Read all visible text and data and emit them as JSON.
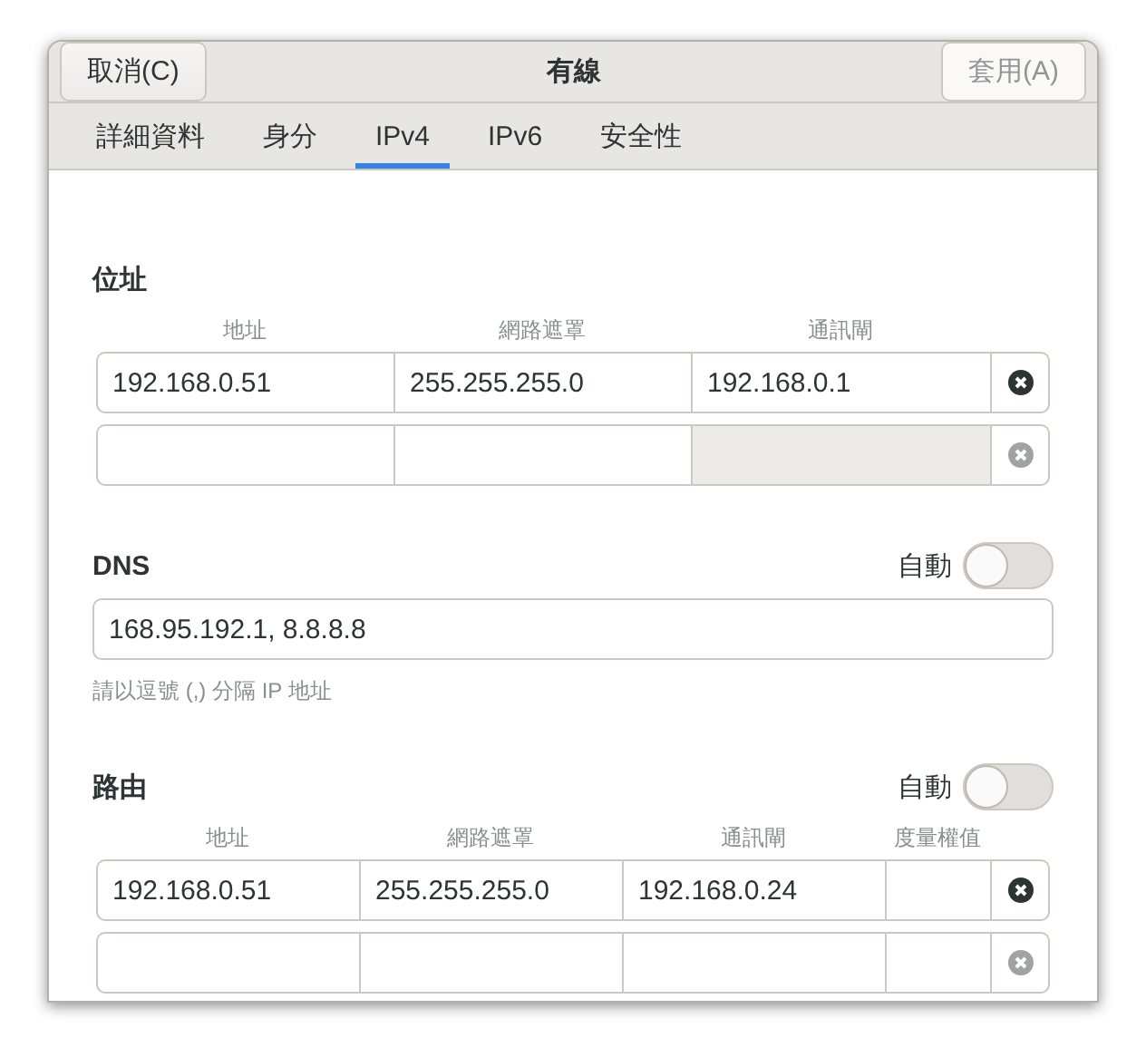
{
  "window": {
    "title": "有線",
    "cancel_button": {
      "label": "取消(C)",
      "disabled": false
    },
    "apply_button": {
      "label": "套用(A)",
      "disabled": true
    }
  },
  "tabs": [
    {
      "label": "詳細資料",
      "selected": false
    },
    {
      "label": "身分",
      "selected": false
    },
    {
      "label": "IPv4",
      "selected": true
    },
    {
      "label": "IPv6",
      "selected": false
    },
    {
      "label": "安全性",
      "selected": false
    }
  ],
  "addresses": {
    "title": "位址",
    "columns": [
      "地址",
      "網路遮罩",
      "通訊閘"
    ],
    "rows": [
      {
        "cells": [
          {
            "value": "192.168.0.51",
            "disabled": false
          },
          {
            "value": "255.255.255.0",
            "disabled": false
          },
          {
            "value": "192.168.0.1",
            "disabled": false
          }
        ],
        "delete_disabled": false
      },
      {
        "cells": [
          {
            "disabled": false
          },
          {
            "disabled": false
          },
          {
            "disabled": true
          }
        ],
        "delete_disabled": true
      }
    ]
  },
  "dns": {
    "title": "DNS",
    "auto_label": "自動",
    "auto": false,
    "value": "168.95.192.1, 8.8.8.8",
    "hint": "請以逗號 (,) 分隔 IP 地址"
  },
  "routes": {
    "title": "路由",
    "auto_label": "自動",
    "auto": false,
    "columns": [
      "地址",
      "網路遮罩",
      "通訊閘",
      "度量權值"
    ],
    "rows": [
      {
        "cells": [
          {
            "value": "192.168.0.51",
            "disabled": false
          },
          {
            "value": "255.255.255.0",
            "disabled": false
          },
          {
            "value": "192.168.0.24",
            "disabled": false
          },
          {
            "disabled": false
          }
        ],
        "delete_disabled": false
      },
      {
        "cells": [
          {
            "disabled": false
          },
          {
            "disabled": false
          },
          {
            "disabled": false
          },
          {
            "disabled": false
          }
        ],
        "delete_disabled": true
      }
    ]
  }
}
